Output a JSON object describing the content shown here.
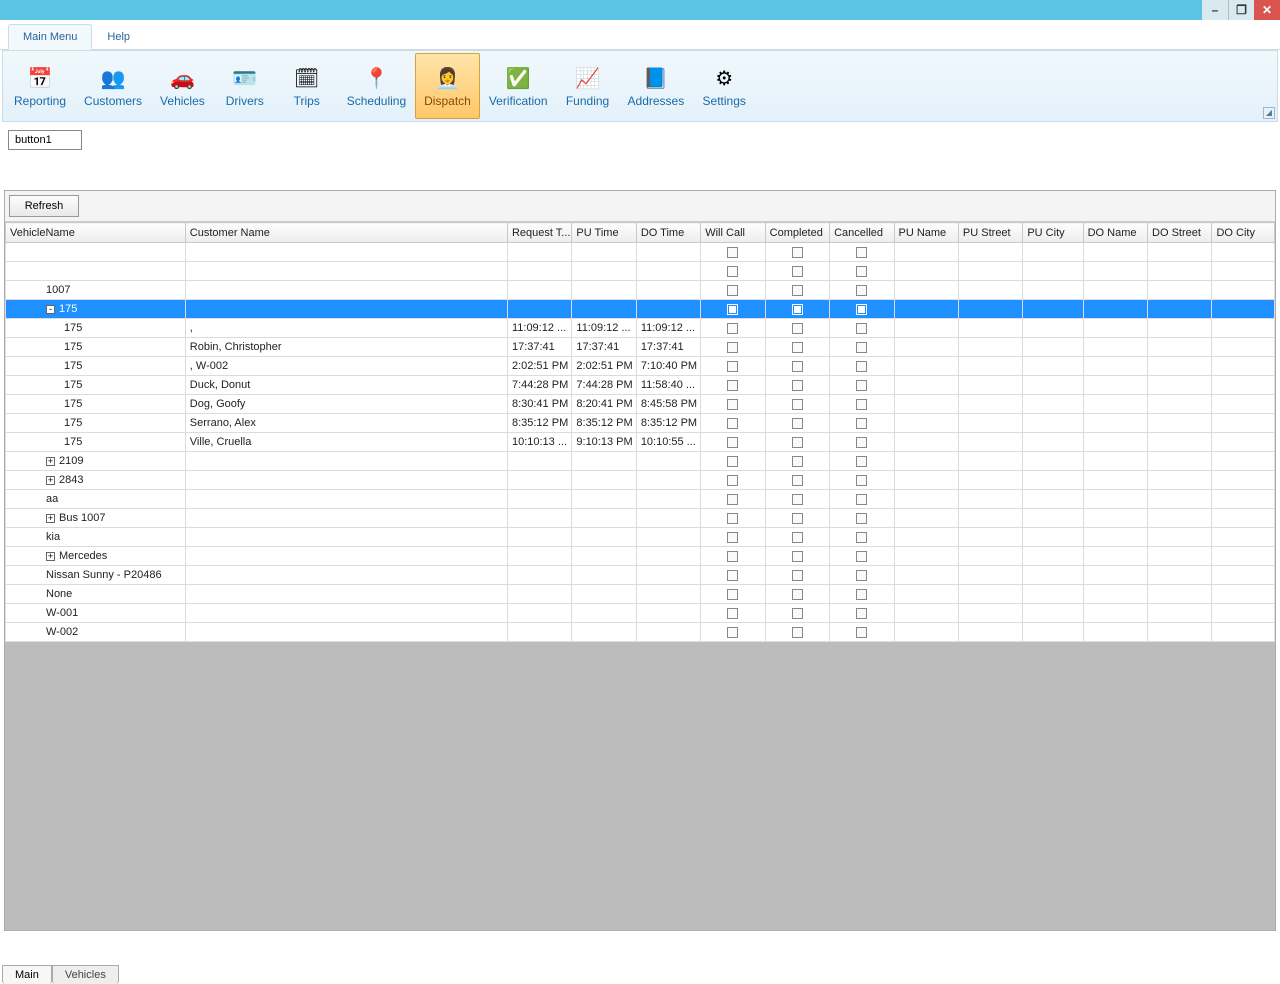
{
  "window": {
    "min": "–",
    "max": "❐",
    "close": "✕"
  },
  "tabs": {
    "main": "Main Menu",
    "help": "Help"
  },
  "ribbon": [
    {
      "id": "reporting",
      "label": "Reporting",
      "icon": "📅"
    },
    {
      "id": "customers",
      "label": "Customers",
      "icon": "👥"
    },
    {
      "id": "vehicles",
      "label": "Vehicles",
      "icon": "🚗"
    },
    {
      "id": "drivers",
      "label": "Drivers",
      "icon": "🪪"
    },
    {
      "id": "trips",
      "label": "Trips",
      "icon": "🗓"
    },
    {
      "id": "scheduling",
      "label": "Scheduling",
      "icon": "📍"
    },
    {
      "id": "dispatch",
      "label": "Dispatch",
      "icon": "👩‍💼",
      "active": true
    },
    {
      "id": "verification",
      "label": "Verification",
      "icon": "✅"
    },
    {
      "id": "funding",
      "label": "Funding",
      "icon": "📈"
    },
    {
      "id": "addresses",
      "label": "Addresses",
      "icon": "📘"
    },
    {
      "id": "settings",
      "label": "Settings",
      "icon": "⚙"
    }
  ],
  "button1": "button1",
  "refresh": "Refresh",
  "columns": {
    "vname": "VehicleName",
    "cust": "Customer Name",
    "req": "Request T...",
    "pu": "PU Time",
    "do": "DO Time",
    "wc": "Will Call",
    "comp": "Completed",
    "canc": "Cancelled",
    "pun": "PU Name",
    "pus": "PU Street",
    "puc": "PU City",
    "don": "DO Name",
    "dos": "DO Street",
    "doc": "DO City"
  },
  "rows": [
    {
      "exp": "",
      "ind": 1,
      "vname": "",
      "cust": "",
      "req": "",
      "pu": "",
      "do": ""
    },
    {
      "exp": "",
      "ind": 1,
      "vname": "",
      "cust": "",
      "req": "",
      "pu": "",
      "do": ""
    },
    {
      "exp": "",
      "ind": 1,
      "vname": "1007",
      "cust": "",
      "req": "",
      "pu": "",
      "do": ""
    },
    {
      "exp": "-",
      "ind": 1,
      "vname": "175",
      "cust": "",
      "req": "",
      "pu": "",
      "do": "",
      "selected": true
    },
    {
      "exp": "",
      "ind": 2,
      "vname": "175",
      "cust": ",",
      "req": "11:09:12 ...",
      "pu": "11:09:12 ...",
      "do": "11:09:12 ..."
    },
    {
      "exp": "",
      "ind": 2,
      "vname": "175",
      "cust": "Robin, Christopher",
      "req": "17:37:41",
      "pu": "17:37:41",
      "do": "17:37:41"
    },
    {
      "exp": "",
      "ind": 2,
      "vname": "175",
      "cust": ", W-002",
      "req": "2:02:51 PM",
      "pu": "2:02:51 PM",
      "do": "7:10:40 PM"
    },
    {
      "exp": "",
      "ind": 2,
      "vname": "175",
      "cust": "Duck, Donut",
      "req": "7:44:28 PM",
      "pu": "7:44:28 PM",
      "do": "11:58:40 ..."
    },
    {
      "exp": "",
      "ind": 2,
      "vname": "175",
      "cust": "Dog, Goofy",
      "req": "8:30:41 PM",
      "pu": "8:20:41 PM",
      "do": "8:45:58 PM"
    },
    {
      "exp": "",
      "ind": 2,
      "vname": "175",
      "cust": "Serrano, Alex",
      "req": "8:35:12 PM",
      "pu": "8:35:12 PM",
      "do": "8:35:12 PM"
    },
    {
      "exp": "",
      "ind": 2,
      "vname": "175",
      "cust": "Ville, Cruella",
      "req": "10:10:13 ...",
      "pu": "9:10:13 PM",
      "do": "10:10:55 ..."
    },
    {
      "exp": "+",
      "ind": 1,
      "vname": "2109",
      "cust": "",
      "req": "",
      "pu": "",
      "do": ""
    },
    {
      "exp": "+",
      "ind": 1,
      "vname": "2843",
      "cust": "",
      "req": "",
      "pu": "",
      "do": ""
    },
    {
      "exp": "",
      "ind": 1,
      "vname": "aa",
      "cust": "",
      "req": "",
      "pu": "",
      "do": ""
    },
    {
      "exp": "+",
      "ind": 1,
      "vname": "Bus 1007",
      "cust": "",
      "req": "",
      "pu": "",
      "do": ""
    },
    {
      "exp": "",
      "ind": 1,
      "vname": "kia",
      "cust": "",
      "req": "",
      "pu": "",
      "do": ""
    },
    {
      "exp": "+",
      "ind": 1,
      "vname": "Mercedes",
      "cust": "",
      "req": "",
      "pu": "",
      "do": ""
    },
    {
      "exp": "",
      "ind": 1,
      "vname": "Nissan Sunny - P20486",
      "cust": "",
      "req": "",
      "pu": "",
      "do": ""
    },
    {
      "exp": "",
      "ind": 1,
      "vname": "None",
      "cust": "",
      "req": "",
      "pu": "",
      "do": ""
    },
    {
      "exp": "",
      "ind": 1,
      "vname": "W-001",
      "cust": "",
      "req": "",
      "pu": "",
      "do": ""
    },
    {
      "exp": "",
      "ind": 1,
      "vname": "W-002",
      "cust": "",
      "req": "",
      "pu": "",
      "do": ""
    }
  ],
  "bottomTabs": {
    "main": "Main",
    "vehicles": "Vehicles"
  }
}
